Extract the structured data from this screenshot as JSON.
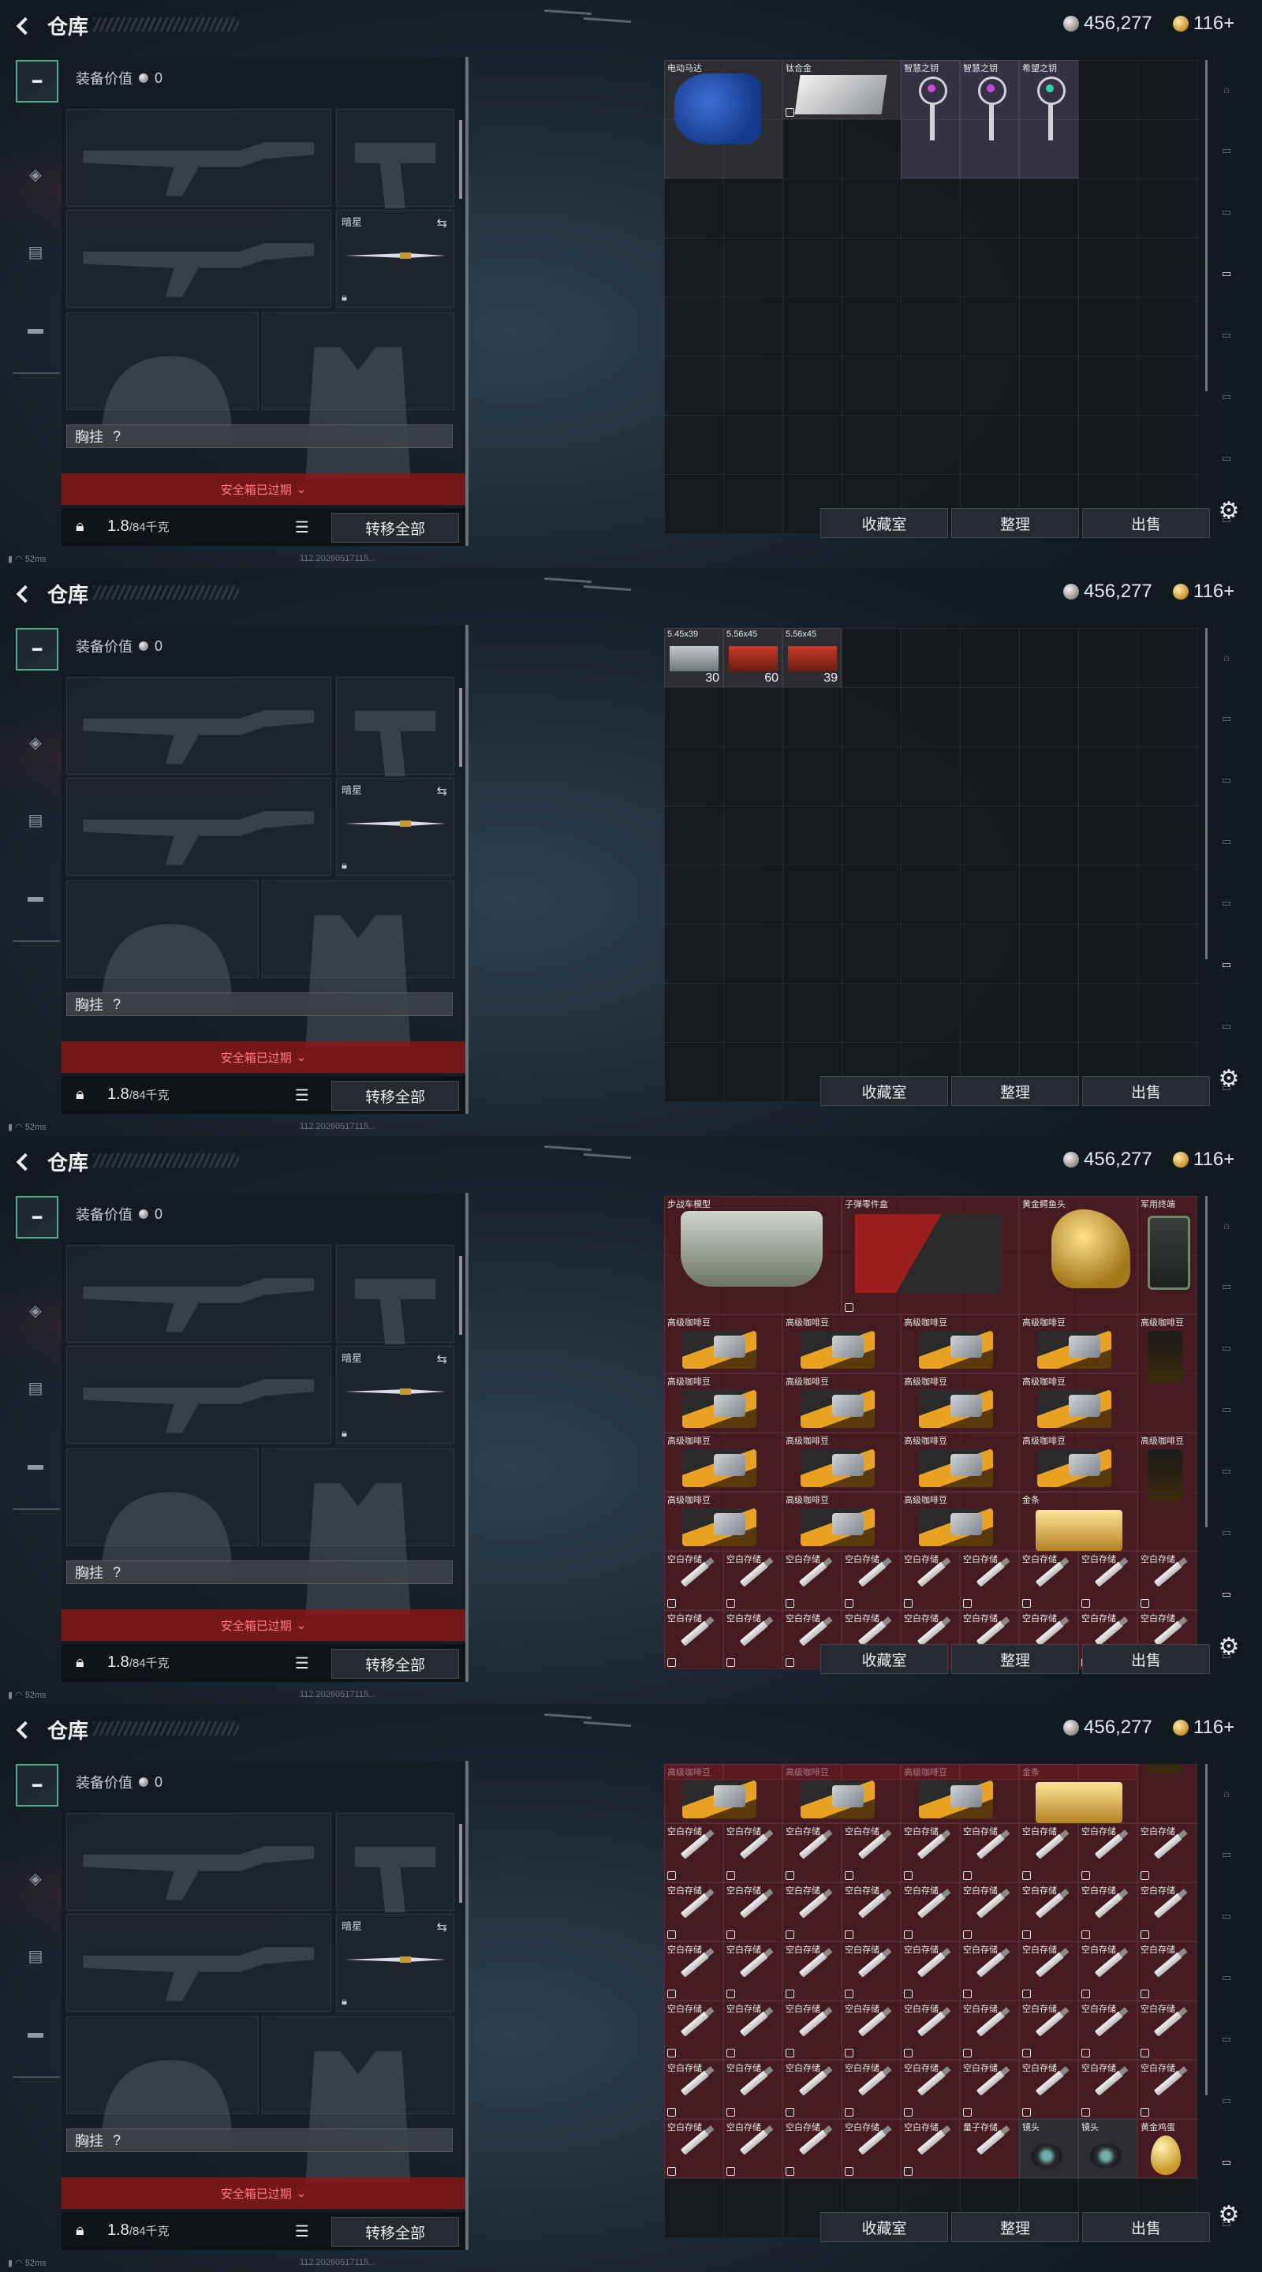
{
  "screens": [
    {
      "id": "s1"
    },
    {
      "id": "s2"
    },
    {
      "id": "s3"
    },
    {
      "id": "s4"
    }
  ],
  "header": {
    "title": "仓库",
    "silver_amount": "456,277",
    "gold_amount": "116+"
  },
  "equipment": {
    "value_label": "装备价值",
    "value": "0",
    "melee_label": "暗星",
    "chest_label": "胸挂",
    "chest_hint": "?",
    "safe_box_label": "安全箱已过期",
    "weight_current": "1.8",
    "weight_max": "/84千克",
    "transfer_all_label": "转移全部"
  },
  "stash_buttons": {
    "collection_label": "收藏室",
    "sort_label": "整理",
    "sell_label": "出售"
  },
  "status": {
    "ping": "52ms",
    "build": "112.20260517115..."
  },
  "stash_pages": {
    "s1": {
      "items": [
        {
          "name": "电动马达"
        },
        {
          "name": "钛合金"
        },
        {
          "name": "智慧之钥"
        },
        {
          "name": "智慧之钥"
        },
        {
          "name": "希望之钥"
        }
      ]
    },
    "s2": {
      "items": [
        {
          "name": "5.45x39",
          "count": "30"
        },
        {
          "name": "5.56x45",
          "count": "60"
        },
        {
          "name": "5.56x45",
          "count": "39"
        }
      ]
    },
    "s3": {
      "big_items": [
        {
          "name": "步战车模型"
        },
        {
          "name": "子弹零件盒"
        },
        {
          "name": "黄金鳄鱼头"
        },
        {
          "name": "军用终端"
        }
      ],
      "coffee_label": "高级咖啡豆",
      "gold_label": "金条",
      "usb_label": "空白存储"
    },
    "s4": {
      "coffee_label": "高级咖啡豆",
      "gold_label": "金条",
      "usb_label": "空白存储",
      "quantum_label": "量子存储",
      "lens_label": "镜头",
      "egg_label": "黄金鸡蛋"
    }
  },
  "colors": {
    "accent_green": "#4fae8a",
    "danger_red": "#ff7d7d",
    "stash_tint": "#6e1c24"
  },
  "icons": {
    "back": "back-icon",
    "settings": "gear-icon",
    "lock": "lock-icon",
    "list": "list-icon",
    "swap": "swap-icon"
  }
}
